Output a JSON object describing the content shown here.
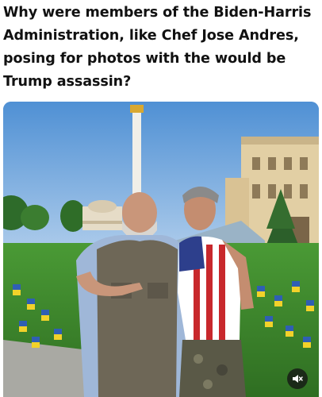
{
  "post": {
    "headline": "Why were members of the Biden-Harris Administration, like Chef Jose Andres, posing for photos with the would be Trump assassin?"
  },
  "media": {
    "type": "photo",
    "icons": {
      "mute": "speaker-muted-icon"
    }
  },
  "colors": {
    "headline_text": "#111111",
    "sky": "#5f9bd6",
    "grass": "#3f8a2e",
    "flag_blue": "#2f5fb4",
    "flag_yellow": "#f2d22a",
    "mute_bg": "#141414"
  }
}
